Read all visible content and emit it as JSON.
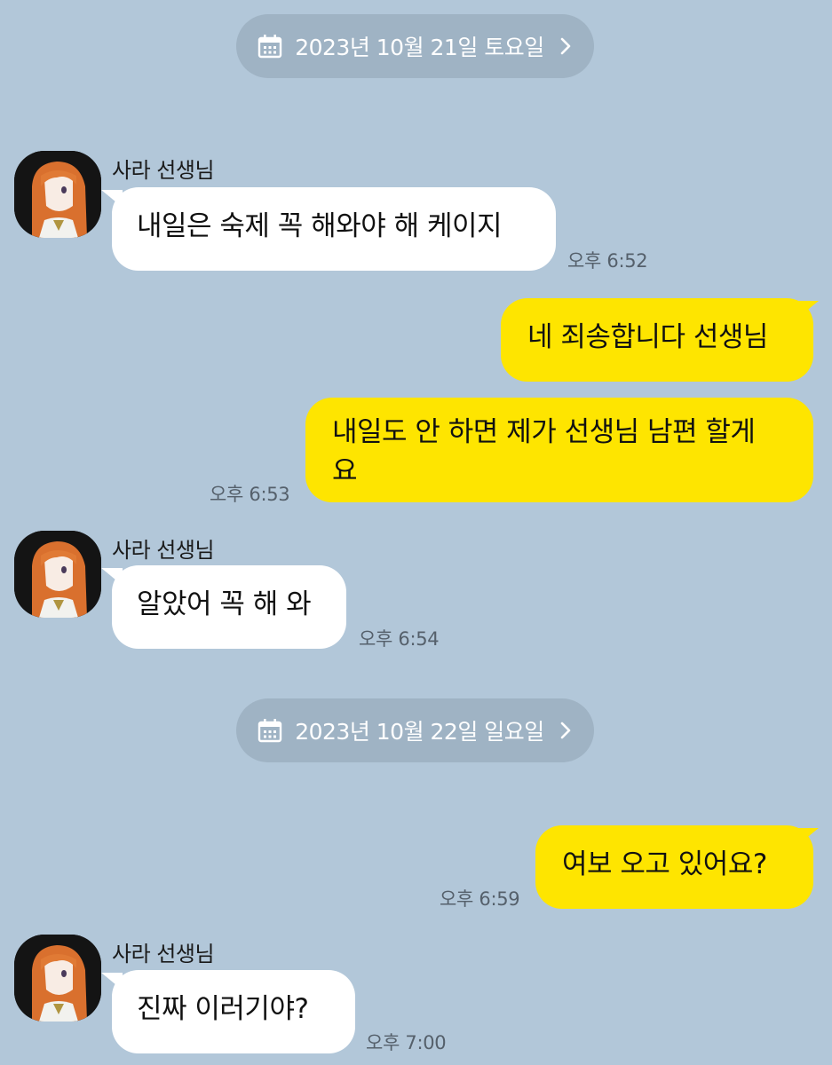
{
  "dates": {
    "first": "2023년 10월 21일 토요일",
    "second": "2023년 10월 22일 일요일"
  },
  "messages": [
    {
      "sender": "사라 선생님",
      "text": "내일은 숙제 꼭 해와야 해 케이지",
      "time": "오후 6:52"
    },
    {
      "text": "네 죄송합니다 선생님"
    },
    {
      "text_line1": "내일도 안 하면 제가 선생님 남편 할게",
      "text_line2": "요",
      "time": "오후 6:53"
    },
    {
      "sender": "사라 선생님",
      "text": "알았어 꼭 해 와",
      "time": "오후 6:54"
    },
    {
      "text": "여보 오고 있어요?",
      "time": "오후 6:59"
    },
    {
      "sender": "사라 선생님",
      "text": "진짜 이러기야?",
      "time": "오후 7:00"
    }
  ],
  "colors": {
    "background": "#b2c7d9",
    "my_bubble": "#fee500",
    "their_bubble": "#ffffff",
    "date_pill": "#9fb3c4"
  },
  "icons": {
    "calendar": "calendar-icon",
    "chevron": "chevron-right-icon",
    "avatar": "profile-avatar"
  }
}
